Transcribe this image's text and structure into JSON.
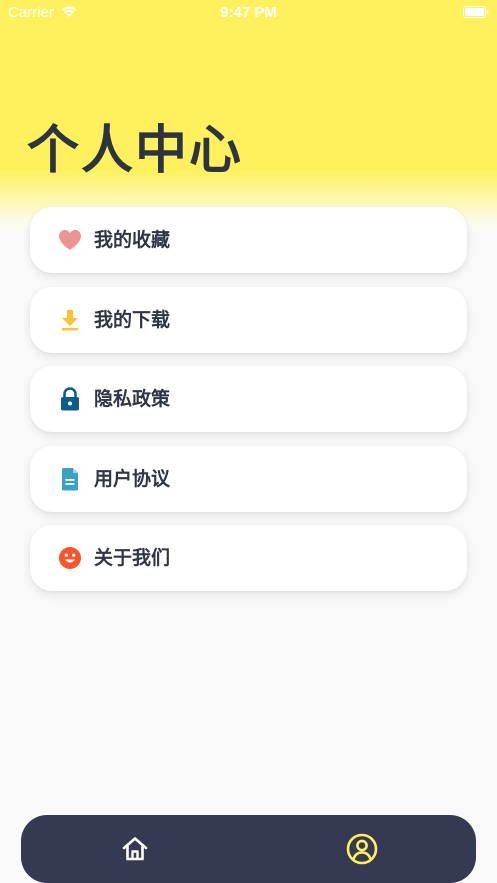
{
  "status_bar": {
    "carrier": "Carrier",
    "time": "9:47 PM"
  },
  "header": {
    "title": "个人中心",
    "background_color": "#fff15e"
  },
  "menu": {
    "items": [
      {
        "label": "我的收藏",
        "icon": "heart-icon",
        "color": "#ec9396"
      },
      {
        "label": "我的下载",
        "icon": "download-icon",
        "color": "#f9c436"
      },
      {
        "label": "隐私政策",
        "icon": "lock-icon",
        "color": "#0d5a8c"
      },
      {
        "label": "用户协议",
        "icon": "document-icon",
        "color": "#3aa0c4"
      },
      {
        "label": "关于我们",
        "icon": "smiley-icon",
        "color": "#f7572a"
      }
    ]
  },
  "tab_bar": {
    "background_color": "#363952",
    "tabs": [
      {
        "name": "home",
        "icon": "home-icon",
        "active": false,
        "color": "#ffffff"
      },
      {
        "name": "profile",
        "icon": "user-circle-icon",
        "active": true,
        "color": "#fff15e"
      }
    ]
  }
}
